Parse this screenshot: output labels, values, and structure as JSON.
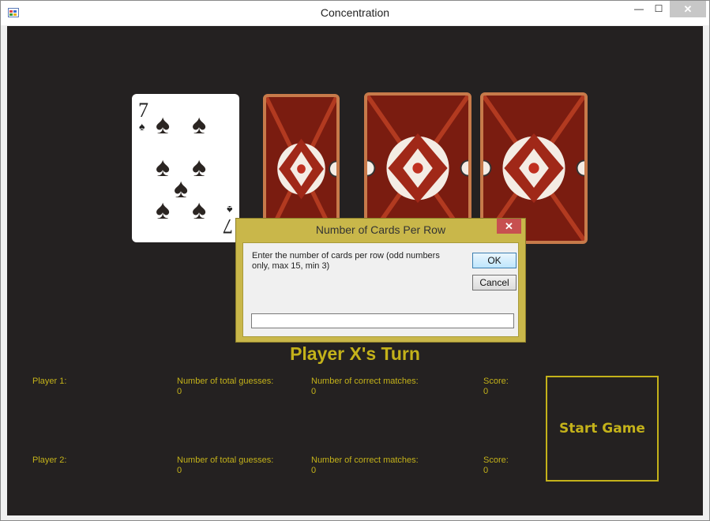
{
  "window": {
    "title": "Concentration",
    "min_glyph": "—",
    "max_glyph": "☐",
    "close_glyph": "✕"
  },
  "cards": [
    {
      "state": "face-up",
      "rank": "7",
      "suit": "spades",
      "suit_glyph": "♠"
    },
    {
      "state": "face-down"
    },
    {
      "state": "face-down"
    },
    {
      "state": "face-down"
    }
  ],
  "game": {
    "turn_label": "Player X's Turn",
    "start_button": "Start Game"
  },
  "players": [
    {
      "label": "Player 1:",
      "guesses_label": "Number of total guesses:",
      "guesses_value": "0",
      "matches_label": "Number of correct matches:",
      "matches_value": "0",
      "score_label": "Score:",
      "score_value": "0"
    },
    {
      "label": "Player 2:",
      "guesses_label": "Number of total guesses:",
      "guesses_value": "0",
      "matches_label": "Number of correct matches:",
      "matches_value": "0",
      "score_label": "Score:",
      "score_value": "0"
    }
  ],
  "dialog": {
    "title": "Number of Cards Per Row",
    "prompt": "Enter the number of cards per row (odd numbers only, max 15, min 3)",
    "ok_label": "OK",
    "cancel_label": "Cancel",
    "input_value": "",
    "close_glyph": "✕"
  },
  "colors": {
    "background": "#242121",
    "accent": "#c4b21a",
    "dialog_frame": "#c9b74a",
    "close_red": "#c75050"
  }
}
